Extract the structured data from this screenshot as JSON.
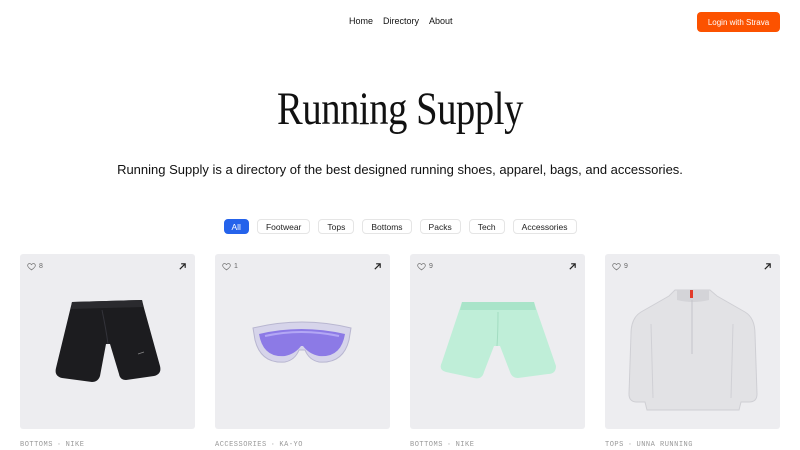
{
  "nav": {
    "links": [
      "Home",
      "Directory",
      "About"
    ],
    "login_label": "Login with Strava",
    "login_color": "#fc5200"
  },
  "hero": {
    "title": "Running Supply",
    "subtitle": "Running Supply is a directory of the best designed running shoes, apparel, bags, and accessories."
  },
  "filters": {
    "items": [
      "All",
      "Footwear",
      "Tops",
      "Bottoms",
      "Packs",
      "Tech",
      "Accessories"
    ],
    "active": "All",
    "active_color": "#2563eb"
  },
  "products": [
    {
      "likes": "8",
      "category": "BOTTOMS",
      "brand": "NIKE",
      "image": "black-running-shorts",
      "icon": "heart-icon"
    },
    {
      "likes": "1",
      "category": "ACCESSORIES",
      "brand": "KA-YO",
      "image": "purple-shield-sunglasses",
      "icon": "heart-icon"
    },
    {
      "likes": "9",
      "category": "BOTTOMS",
      "brand": "NIKE",
      "image": "mint-running-shorts",
      "icon": "heart-icon"
    },
    {
      "likes": "9",
      "category": "TOPS",
      "brand": "UNNA RUNNING",
      "image": "grey-half-zip-jacket",
      "icon": "heart-icon"
    }
  ]
}
